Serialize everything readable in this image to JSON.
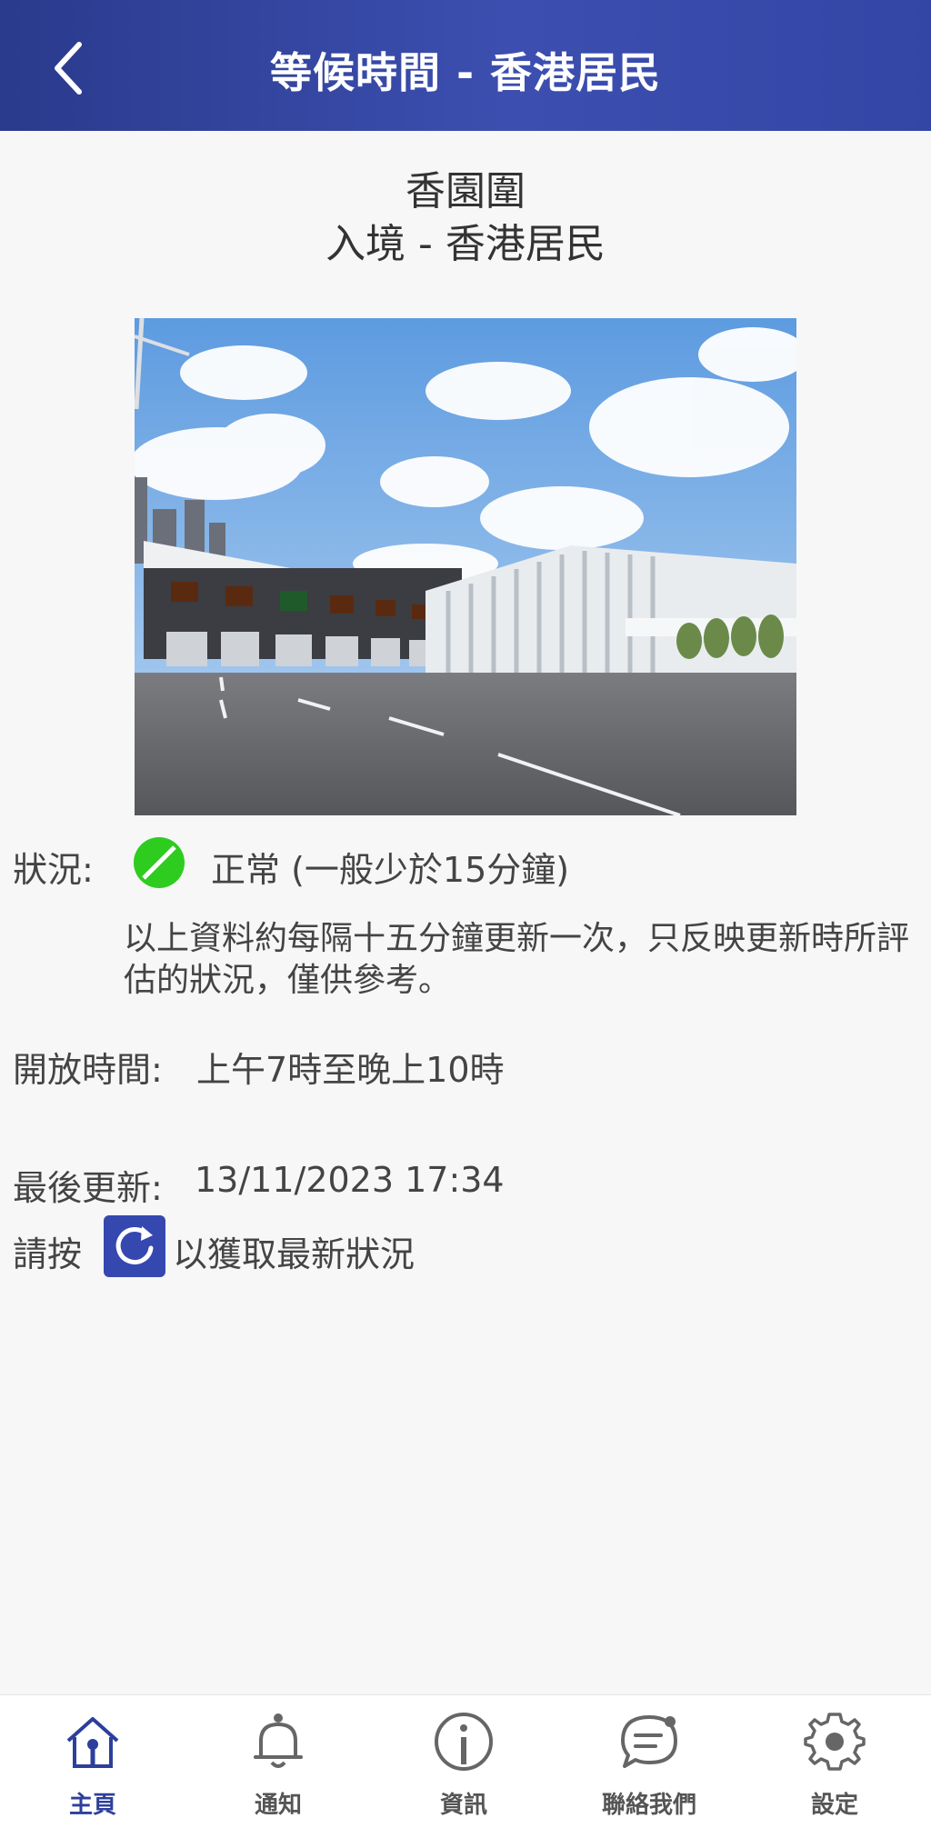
{
  "header": {
    "title": "等候時間 - 香港居民",
    "back_icon": "chevron-left-icon"
  },
  "location": {
    "name": "香園圍",
    "direction": "入境 - 香港居民"
  },
  "photo": {
    "description_icon": "checkpoint-photo"
  },
  "status": {
    "label": "狀況:",
    "indicator_color": "#2ecc1f",
    "text": "正常 (一般少於15分鐘)",
    "note": "以上資料約每隔十五分鐘更新一次，只反映更新時所評估的狀況，僅供參考。"
  },
  "hours": {
    "label": "開放時間:",
    "value": "上午7時至晚上10時"
  },
  "updated": {
    "label": "最後更新:",
    "value": "13/11/2023 17:34"
  },
  "refresh": {
    "prefix": "請按",
    "suffix": "以獲取最新狀況",
    "icon": "refresh-icon"
  },
  "tabbar": {
    "accent": "#2d3f9c",
    "items": [
      {
        "label": "主頁",
        "icon": "home-icon",
        "active": true
      },
      {
        "label": "通知",
        "icon": "bell-icon",
        "active": false
      },
      {
        "label": "資訊",
        "icon": "info-icon",
        "active": false
      },
      {
        "label": "聯絡我們",
        "icon": "chat-icon",
        "active": false
      },
      {
        "label": "設定",
        "icon": "gear-icon",
        "active": false
      }
    ]
  }
}
